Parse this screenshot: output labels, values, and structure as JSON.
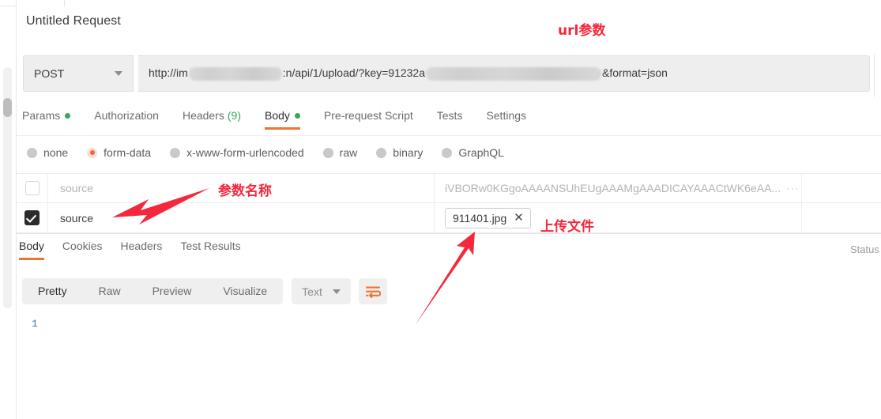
{
  "request": {
    "title": "Untitled Request",
    "method": "POST",
    "url_prefix": "http://im",
    "url_mid": ":n/api/1/upload/?key=91232a",
    "url_suffix": "&format=json"
  },
  "request_tabs": [
    {
      "label": "Params",
      "badge": "dot",
      "active": false
    },
    {
      "label": "Authorization",
      "badge": "",
      "active": false
    },
    {
      "label": "Headers",
      "badge": "(9)",
      "active": false
    },
    {
      "label": "Body",
      "badge": "dot",
      "active": true
    },
    {
      "label": "Pre-request Script",
      "badge": "",
      "active": false
    },
    {
      "label": "Tests",
      "badge": "",
      "active": false
    },
    {
      "label": "Settings",
      "badge": "",
      "active": false
    }
  ],
  "body_types": [
    {
      "label": "none",
      "selected": false
    },
    {
      "label": "form-data",
      "selected": true
    },
    {
      "label": "x-www-form-urlencoded",
      "selected": false
    },
    {
      "label": "raw",
      "selected": false
    },
    {
      "label": "binary",
      "selected": false
    },
    {
      "label": "GraphQL",
      "selected": false
    }
  ],
  "form_data_rows": [
    {
      "checked": false,
      "key": "source",
      "key_is_placeholder": true,
      "value": "iVBORw0KGgoAAAANSUhEUgAAAMgAAADICAYAAACtWK6eAA...",
      "value_is_placeholder": true,
      "value_type": "text",
      "overflow_dots": "···"
    },
    {
      "checked": true,
      "key": "source",
      "key_is_placeholder": false,
      "value": "911401.jpg",
      "value_is_placeholder": false,
      "value_type": "file",
      "remove_label": "✕"
    }
  ],
  "response_tabs": [
    {
      "label": "Body",
      "active": true
    },
    {
      "label": "Cookies",
      "active": false
    },
    {
      "label": "Headers",
      "active": false
    },
    {
      "label": "Test Results",
      "active": false
    }
  ],
  "response_status_label": "Status",
  "view_modes": [
    {
      "label": "Pretty",
      "active": true
    },
    {
      "label": "Raw",
      "active": false
    },
    {
      "label": "Preview",
      "active": false
    },
    {
      "label": "Visualize",
      "active": false
    }
  ],
  "format_selector": {
    "label": "Text"
  },
  "wrap_button": {
    "icon": "word-wrap-icon"
  },
  "editor": {
    "line_number": "1",
    "content": ""
  },
  "annotations": [
    {
      "text": "url参数",
      "meaning": "url-parameter"
    },
    {
      "text": "参数名称",
      "meaning": "parameter-name"
    },
    {
      "text": "上传文件",
      "meaning": "upload-file"
    }
  ],
  "colors": {
    "accent": "#ef7330",
    "annotation_red": "#f4283c",
    "green_dot": "#3aa757",
    "line_number_blue": "#2f7aa3"
  }
}
